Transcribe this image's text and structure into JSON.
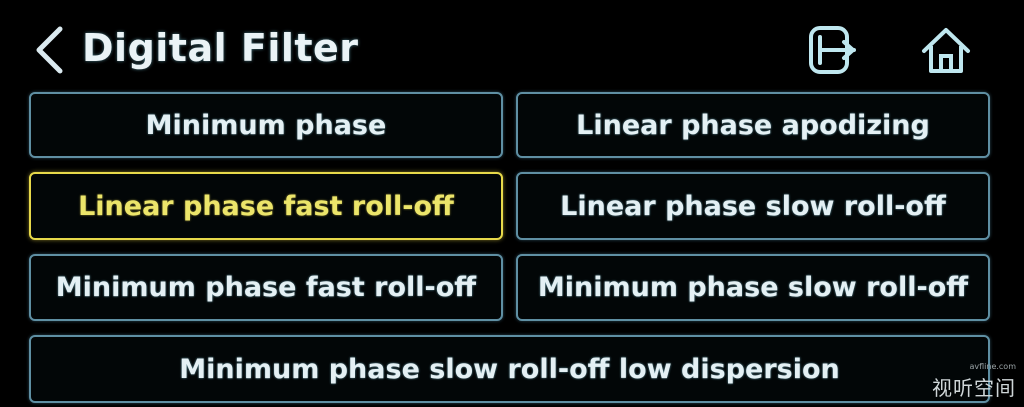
{
  "header": {
    "title": "Digital Filter",
    "back_icon": "chevron-left-icon",
    "input_icon": "input-source-icon",
    "home_icon": "home-icon"
  },
  "options": [
    {
      "label": "Minimum phase",
      "selected": false
    },
    {
      "label": "Linear phase apodizing",
      "selected": false
    },
    {
      "label": "Linear phase fast roll-off",
      "selected": true
    },
    {
      "label": "Linear phase slow roll-off",
      "selected": false
    },
    {
      "label": "Minimum phase fast roll-off",
      "selected": false
    },
    {
      "label": "Minimum phase slow roll-off",
      "selected": false
    },
    {
      "label": "Minimum phase slow roll-off low dispersion",
      "selected": false
    }
  ],
  "colors": {
    "background": "#000000",
    "border": "#5f8fa3",
    "selected": "#e7d94a",
    "text": "#e4f0f4"
  },
  "watermark": {
    "site": "avfline.com",
    "name": "视听空间"
  }
}
